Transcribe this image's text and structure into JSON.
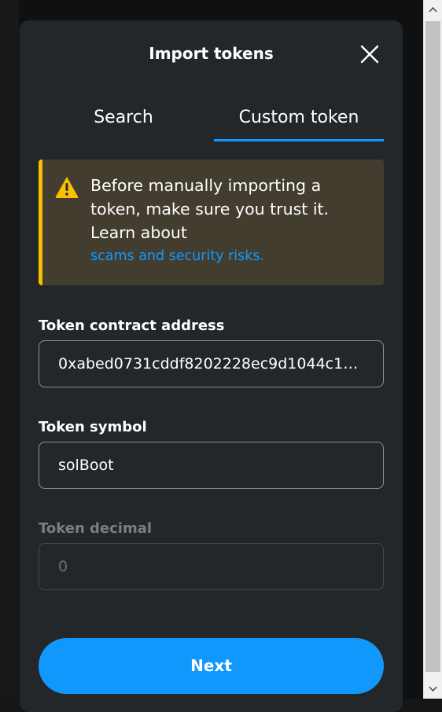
{
  "modal": {
    "title": "Import tokens"
  },
  "tabs": [
    {
      "label": "Search",
      "active": false
    },
    {
      "label": "Custom token",
      "active": true
    }
  ],
  "warning": {
    "text": "Before manually importing a token, make sure you trust it. Learn about",
    "link": "scams and security risks."
  },
  "fields": {
    "address": {
      "label": "Token contract address",
      "value": "0xabed0731cddf8202228ec9d1044c15..."
    },
    "symbol": {
      "label": "Token symbol",
      "value": "solBoot"
    },
    "decimal": {
      "label": "Token decimal",
      "value": "0"
    }
  },
  "actions": {
    "next_label": "Next"
  },
  "colors": {
    "accent": "#1098fc",
    "warning_border": "#f8c000",
    "modal_bg": "#24272a"
  }
}
